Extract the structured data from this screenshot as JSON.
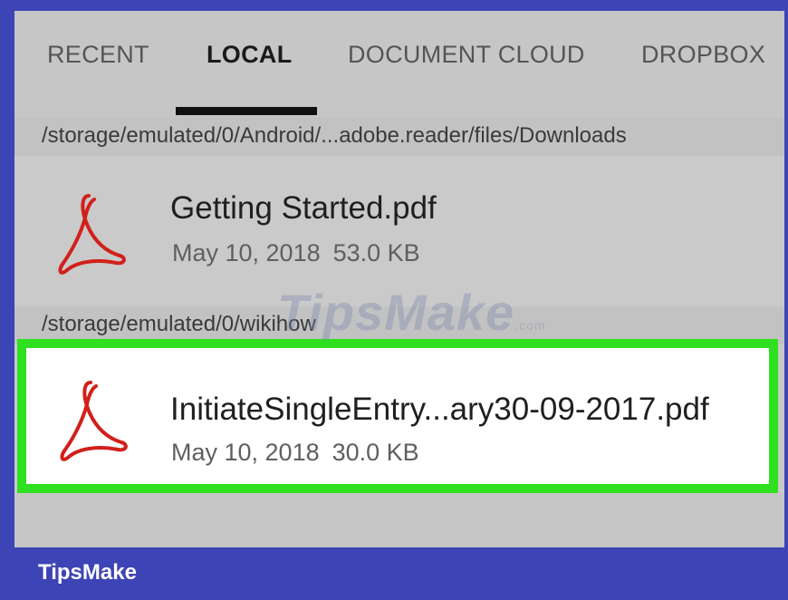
{
  "tabs": [
    {
      "label": "RECENT",
      "active": false
    },
    {
      "label": "LOCAL",
      "active": true
    },
    {
      "label": "DOCUMENT CLOUD",
      "active": false
    },
    {
      "label": "DROPBOX",
      "active": false
    }
  ],
  "sections": [
    {
      "path": "/storage/emulated/0/Android/...adobe.reader/files/Downloads",
      "files": [
        {
          "name": "Getting Started.pdf",
          "date": "May 10, 2018",
          "size": "53.0 KB",
          "icon": "adobe-pdf-icon",
          "selected": false
        }
      ]
    },
    {
      "path": "/storage/emulated/0/wikihow",
      "files": [
        {
          "name": "InitiateSingleEntry...ary30-09-2017.pdf",
          "date": "May 10, 2018",
          "size": "30.0 KB",
          "icon": "adobe-pdf-icon",
          "selected": true
        }
      ]
    }
  ],
  "watermark": {
    "text": "TipsMake",
    "suffix": ".com"
  },
  "footer": {
    "brand": "TipsMake"
  },
  "colors": {
    "frame": "#3d44b5",
    "screen_bg": "#c9c9c9",
    "selection_border": "#2fe021",
    "pdf_icon_red": "#d1201b"
  }
}
